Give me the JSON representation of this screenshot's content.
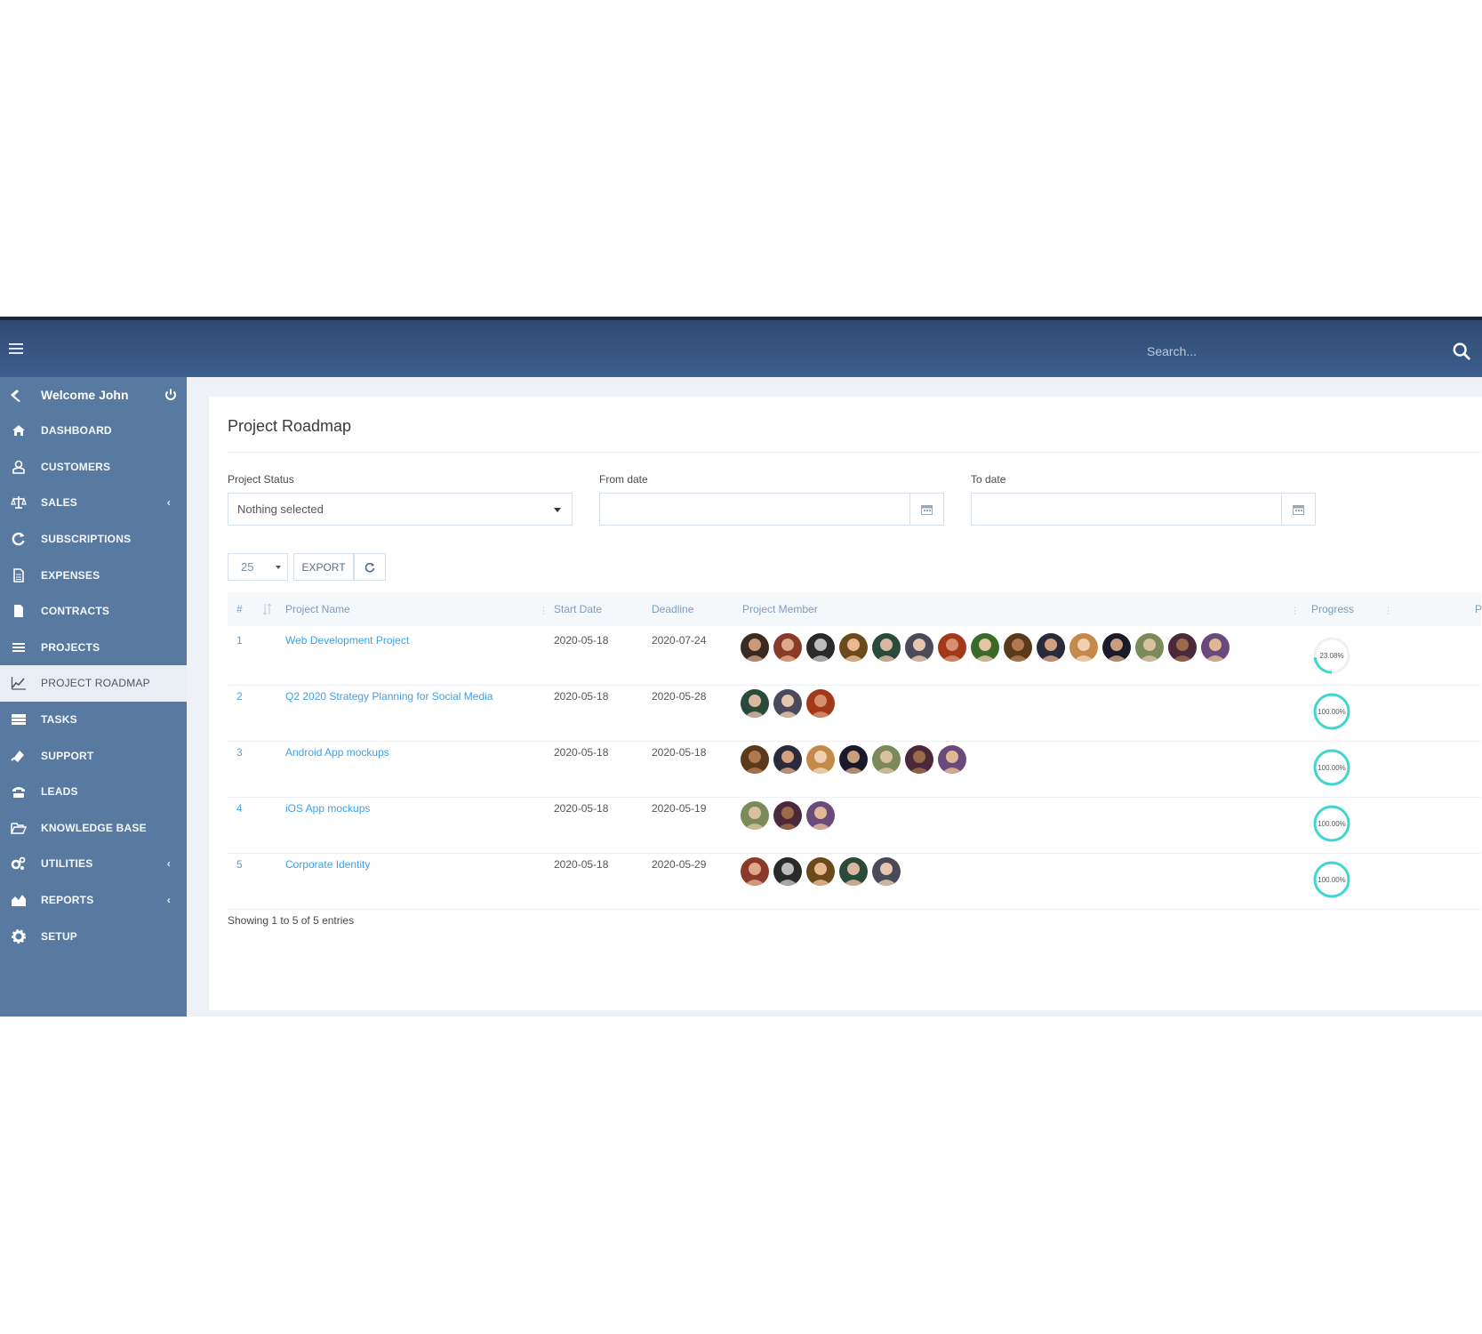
{
  "topbar": {
    "search_placeholder": "Search..."
  },
  "sidebar": {
    "welcome": "Welcome John",
    "items": [
      {
        "label": "DASHBOARD",
        "icon": "home-icon",
        "chevron": false,
        "active": false
      },
      {
        "label": "CUSTOMERS",
        "icon": "user-icon",
        "chevron": false,
        "active": false
      },
      {
        "label": "SALES",
        "icon": "balance-scale-icon",
        "chevron": true,
        "active": false
      },
      {
        "label": "SUBSCRIPTIONS",
        "icon": "refresh-icon",
        "chevron": false,
        "active": false
      },
      {
        "label": "EXPENSES",
        "icon": "file-text-icon",
        "chevron": false,
        "active": false
      },
      {
        "label": "CONTRACTS",
        "icon": "file-icon",
        "chevron": false,
        "active": false
      },
      {
        "label": "PROJECTS",
        "icon": "bars-icon",
        "chevron": false,
        "active": false
      },
      {
        "label": "PROJECT ROADMAP",
        "icon": "line-chart-icon",
        "chevron": false,
        "active": true
      },
      {
        "label": "TASKS",
        "icon": "tasks-icon",
        "chevron": false,
        "active": false
      },
      {
        "label": "SUPPORT",
        "icon": "ticket-icon",
        "chevron": false,
        "active": false
      },
      {
        "label": "LEADS",
        "icon": "tty-icon",
        "chevron": false,
        "active": false
      },
      {
        "label": "KNOWLEDGE BASE",
        "icon": "folder-open-icon",
        "chevron": false,
        "active": false
      },
      {
        "label": "UTILITIES",
        "icon": "cogs-icon",
        "chevron": true,
        "active": false
      },
      {
        "label": "REPORTS",
        "icon": "area-chart-icon",
        "chevron": true,
        "active": false
      },
      {
        "label": "SETUP",
        "icon": "gear-icon",
        "chevron": false,
        "active": false
      }
    ]
  },
  "page": {
    "title": "Project Roadmap"
  },
  "filters": {
    "status_label": "Project Status",
    "status_value": "Nothing selected",
    "from_label": "From date",
    "to_label": "To date"
  },
  "toolbar": {
    "page_length": "25",
    "export_label": "EXPORT"
  },
  "table": {
    "headers": [
      "#",
      "Project Name",
      "Start Date",
      "Deadline",
      "Project Member",
      "Progress",
      "P"
    ],
    "rows": [
      {
        "num": "1",
        "name": "Web Development Project",
        "start": "2020-05-18",
        "deadline": "2020-07-24",
        "members": 15,
        "progress_label": "23.08%",
        "progress": 0.2308
      },
      {
        "num": "2",
        "name": "Q2 2020 Strategy Planning for Social Media",
        "start": "2020-05-18",
        "deadline": "2020-05-28",
        "members": 3,
        "progress_label": "100.00%",
        "progress": 1.0
      },
      {
        "num": "3",
        "name": "Android App mockups",
        "start": "2020-05-18",
        "deadline": "2020-05-18",
        "members": 7,
        "progress_label": "100.00%",
        "progress": 1.0
      },
      {
        "num": "4",
        "name": "iOS App mockups",
        "start": "2020-05-18",
        "deadline": "2020-05-19",
        "members": 3,
        "progress_label": "100.00%",
        "progress": 1.0
      },
      {
        "num": "5",
        "name": "Corporate Identity",
        "start": "2020-05-18",
        "deadline": "2020-05-29",
        "members": 5,
        "progress_label": "100.00%",
        "progress": 1.0
      }
    ],
    "footer": "Showing 1 to 5 of 5 entries"
  },
  "colors": {
    "topbar": "#3d5f8d",
    "sidebar": "#587aa0",
    "link": "#3fa0e6",
    "progress": "#3fd6d1"
  }
}
